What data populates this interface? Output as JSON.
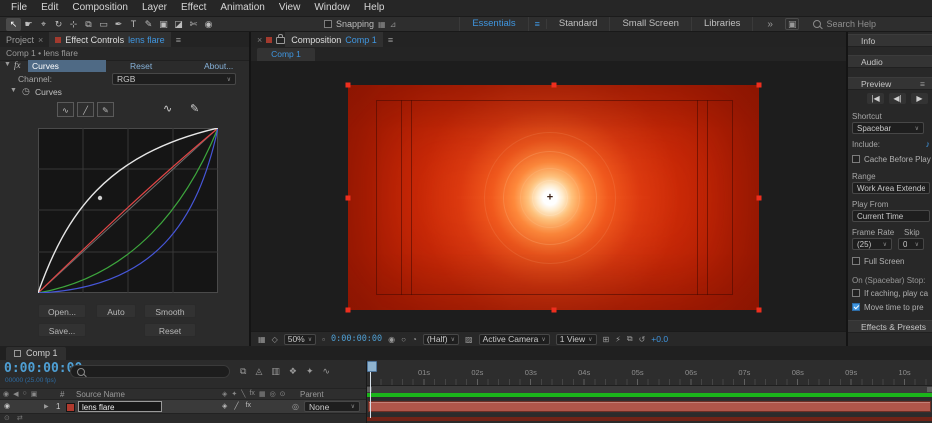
{
  "colors": {
    "accent_blue": "#3f96e0",
    "link_blue": "#86b1d8",
    "timecode_blue": "#4e9fd4",
    "cached_green": "#1bb51b",
    "layer_bar_fill": "#b0564a",
    "comp_red": "#c22304",
    "handle_red": "#ee2e1e",
    "curve_white": "#e6e6e6",
    "curve_red": "#e04545",
    "curve_green": "#3da63d",
    "curve_blue": "#4656d8"
  },
  "icons": {
    "menu": "≡",
    "close": "×",
    "collapse_open": "▼",
    "collapse_closed": "▶",
    "chevron": "∨",
    "stopwatch": "◷",
    "pick_whip": "◎",
    "anchor_cross": "+",
    "note": "♪",
    "workspace_box": "▣",
    "transport_first": "|◀",
    "transport_prev": "◀|",
    "transport_play": "▶",
    "toggle_a": "⊙",
    "toggle_b": "⇄"
  },
  "menu_bar": {
    "items": [
      "File",
      "Edit",
      "Composition",
      "Layer",
      "Effect",
      "Animation",
      "View",
      "Window",
      "Help"
    ]
  },
  "toolbar": {
    "tools": [
      {
        "name": "selection-tool",
        "glyph": "↖"
      },
      {
        "name": "hand-tool",
        "glyph": "☛"
      },
      {
        "name": "zoom-tool",
        "glyph": "⌖"
      },
      {
        "name": "orbit-camera-tool",
        "glyph": "↻"
      },
      {
        "name": "pan-camera-tool",
        "glyph": "⊹"
      },
      {
        "name": "pan-behind-tool",
        "glyph": "⧉"
      },
      {
        "name": "shape-tool",
        "glyph": "▭"
      },
      {
        "name": "pen-tool",
        "glyph": "✒"
      },
      {
        "name": "type-tool",
        "glyph": "T"
      },
      {
        "name": "brush-tool",
        "glyph": "✎"
      },
      {
        "name": "clone-stamp-tool",
        "glyph": "▣"
      },
      {
        "name": "eraser-tool",
        "glyph": "◪"
      },
      {
        "name": "roto-brush-tool",
        "glyph": "✄"
      },
      {
        "name": "puppet-pin-tool",
        "glyph": "◉"
      }
    ],
    "snapping_label": "Snapping",
    "snap_icons": [
      {
        "name": "snap-option-grid-icon",
        "glyph": "▦"
      },
      {
        "name": "snap-option-guides-icon",
        "glyph": "⊿"
      }
    ],
    "workspaces": [
      "Essentials",
      "Standard",
      "Small Screen",
      "Libraries"
    ],
    "active_workspace": "Essentials",
    "overflow": "»",
    "search_label": "Search Help"
  },
  "effect_controls": {
    "tab_project": "Project",
    "tab_effect_controls": "Effect Controls",
    "tab_target": "lens flare",
    "breadcrumb": "Comp 1 • lens flare",
    "effect": {
      "fx_label": "fx",
      "name": "Curves",
      "reset": "Reset",
      "about": "About...",
      "channel_label": "Channel:",
      "channel_value": "RGB",
      "group_label": "Curves"
    },
    "curve_tool_icons": [
      {
        "name": "curve-box-icon",
        "glyph": "∿"
      },
      {
        "name": "line-box-icon",
        "glyph": "╱"
      },
      {
        "name": "pencil-box-icon",
        "glyph": "✎"
      }
    ],
    "curve_mode_icons": [
      {
        "name": "smooth-curve-icon",
        "glyph": "∿"
      },
      {
        "name": "draw-pencil-icon",
        "glyph": "✎"
      }
    ],
    "buttons": {
      "open": "Open...",
      "auto": "Auto",
      "smooth": "Smooth",
      "save": "Save...",
      "reset": "Reset"
    }
  },
  "composition": {
    "tab_label": "Composition",
    "tab_target": "Comp 1",
    "viewer_tab": "Comp 1",
    "footer": {
      "zoom": "50%",
      "timecode": "0:00:00:00",
      "resolution": "(Half)",
      "camera": "Active Camera",
      "view": "1 View",
      "exposure": "+0.0"
    },
    "footer_icons": {
      "grid_options": "▦",
      "mask_visibility": "◇",
      "roi": "▫",
      "snapshot": "◉",
      "show_snapshot": "○",
      "channels": "◔",
      "transparency": "▨",
      "pixel_aspect": "⊞",
      "fast_preview": "⚡",
      "mini_flowchart": "⧉",
      "exposure_reset": "↺"
    }
  },
  "preview_panel": {
    "headers": {
      "info": "Info",
      "audio": "Audio",
      "preview": "Preview",
      "effects_presets": "Effects & Presets"
    },
    "shortcut_label": "Shortcut",
    "shortcut_value": "Spacebar",
    "include_label": "Include:",
    "cache_before_play": "Cache Before Play",
    "range_label": "Range",
    "range_value": "Work Area Extended",
    "play_from_label": "Play From",
    "play_from_value": "Current Time",
    "frame_rate_label": "Frame Rate",
    "skip_label": "Skip",
    "frame_rate_value": "(25)",
    "skip_value": "0",
    "full_screen": "Full Screen",
    "on_stop_label": "On (Spacebar) Stop:",
    "if_caching": "If caching, play ca",
    "move_time": "Move time to pre"
  },
  "timeline": {
    "tab": "Comp 1",
    "timecode": "0:00:00:00",
    "frame_info": "00000 (25.00 fps)",
    "columns": {
      "hash": "#",
      "source_name": "Source Name",
      "parent": "Parent"
    },
    "layer": {
      "number": "1",
      "name": "lens flare",
      "parent_value": "None"
    },
    "ruler_labels": [
      "01s",
      "02s",
      "03s",
      "04s",
      "05s",
      "06s",
      "07s",
      "08s",
      "09s",
      "10s"
    ],
    "panel_icons": [
      {
        "name": "comp-mini-flowchart-icon",
        "glyph": "⧉"
      },
      {
        "name": "draft-3d-icon",
        "glyph": "◬"
      },
      {
        "name": "hide-shy-layers-icon",
        "glyph": "▥"
      },
      {
        "name": "frame-blending-icon",
        "glyph": "❖"
      },
      {
        "name": "motion-blur-icon",
        "glyph": "✦"
      },
      {
        "name": "graph-editor-icon",
        "glyph": "∿"
      }
    ],
    "av_icons": [
      "◉",
      "◀",
      "○",
      "▣"
    ],
    "switch_icons": [
      "◈",
      "✦",
      "╲",
      "fx",
      "▦",
      "◎",
      "⊙"
    ],
    "layer_switches": [
      "◈",
      "╱",
      "fx"
    ]
  }
}
